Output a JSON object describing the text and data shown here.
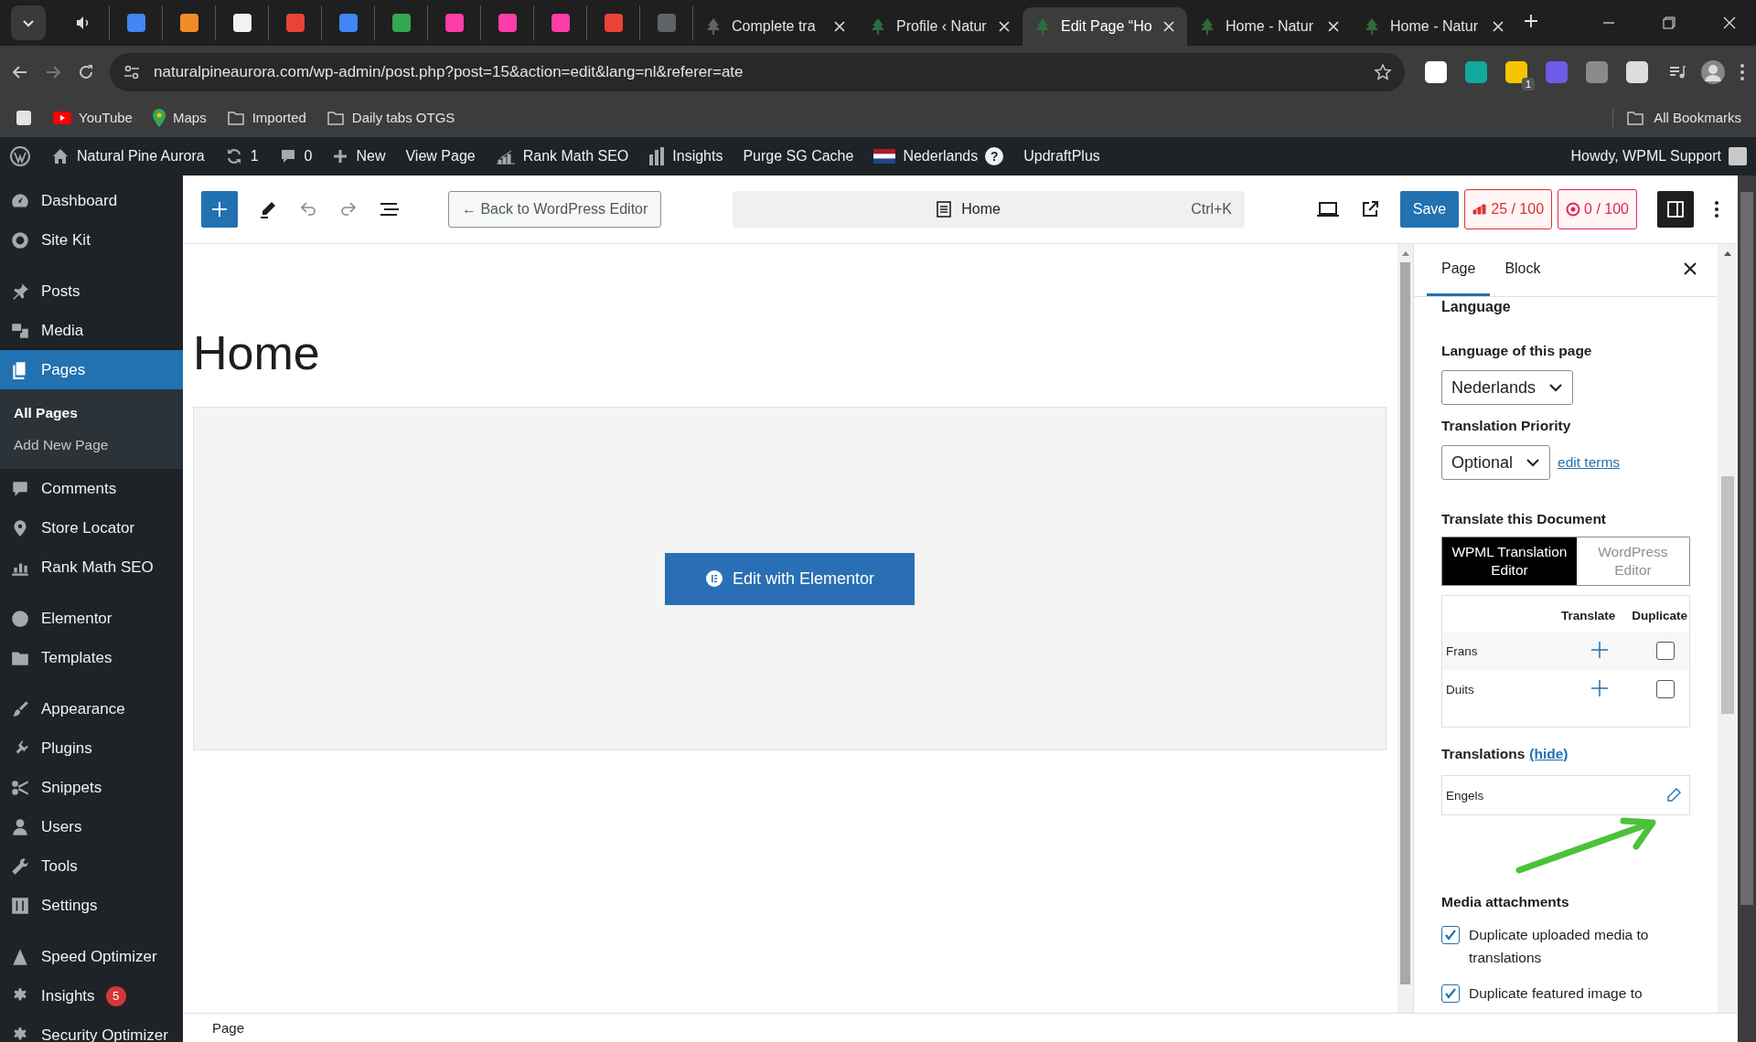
{
  "browser": {
    "tabs": [
      {
        "kind": "audio",
        "color": "#dddddd"
      },
      {
        "kind": "icon",
        "color": "#4285f4"
      },
      {
        "kind": "icon",
        "color": "#f28c28"
      },
      {
        "kind": "icon",
        "color": "#f2f2f2"
      },
      {
        "kind": "icon",
        "color": "#ea4335"
      },
      {
        "kind": "icon",
        "color": "#4285f4"
      },
      {
        "kind": "icon",
        "color": "#34a853"
      },
      {
        "kind": "icon",
        "color": "#ff3da8"
      },
      {
        "kind": "icon",
        "color": "#ff3da8"
      },
      {
        "kind": "icon",
        "color": "#ff3da8"
      },
      {
        "kind": "icon",
        "color": "#ea4335"
      },
      {
        "kind": "icon",
        "color": "#5f6368"
      },
      {
        "kind": "page",
        "title": "Complete tra",
        "selected": false,
        "color": "#5f6368"
      },
      {
        "kind": "page",
        "title": "Profile ‹ Natur",
        "selected": false,
        "color": "#2e6b3a"
      },
      {
        "kind": "page",
        "title": "Edit Page “Ho",
        "selected": true,
        "color": "#2e6b3a"
      },
      {
        "kind": "page",
        "title": "Home - Natur",
        "selected": false,
        "color": "#2e6b3a"
      },
      {
        "kind": "page",
        "title": "Home - Natur",
        "selected": false,
        "color": "#2e6b3a"
      }
    ],
    "address": "naturalpineaurora.com/wp-admin/post.php?post=15&action=edit&lang=nl&referer=ate",
    "extensions": [
      {
        "color": "#ffffff"
      },
      {
        "color": "#13a89e"
      },
      {
        "color": "#f7c500",
        "badge": "1"
      },
      {
        "color": "#6c5ce7"
      },
      {
        "color": "#8a8a8a"
      },
      {
        "color": "#dddddd"
      }
    ],
    "bookmarks": [
      {
        "label": "YouTube",
        "kind": "youtube"
      },
      {
        "label": "Maps",
        "kind": "maps"
      },
      {
        "label": "Imported",
        "kind": "folder"
      },
      {
        "label": "Daily tabs OTGS",
        "kind": "folder"
      }
    ],
    "all_bookmarks": "All Bookmarks"
  },
  "admin_bar": {
    "site": "Natural Pine Aurora",
    "updates": "1",
    "comments": "0",
    "new": "New",
    "items": [
      {
        "label": "View Page",
        "kind": "text"
      },
      {
        "label": "Rank Math SEO",
        "kind": "rankmath"
      },
      {
        "label": "Insights",
        "kind": "chart"
      },
      {
        "label": "Purge SG Cache",
        "kind": "text"
      }
    ],
    "language": "Nederlands",
    "help": "?",
    "updraft": "UpdraftPlus",
    "howdy": "Howdy, WPML Support"
  },
  "sidebar": {
    "groups": [
      [
        {
          "label": "Dashboard",
          "selected": false
        },
        {
          "label": "Site Kit",
          "selected": false
        }
      ],
      [
        {
          "label": "Posts",
          "selected": false
        },
        {
          "label": "Media",
          "selected": false
        },
        {
          "label": "Pages",
          "selected": true,
          "children": [
            {
              "label": "All Pages",
              "selected": true
            },
            {
              "label": "Add New Page",
              "selected": false
            }
          ]
        },
        {
          "label": "Comments",
          "selected": false
        },
        {
          "label": "Store Locator",
          "selected": false
        },
        {
          "label": "Rank Math SEO",
          "selected": false
        }
      ],
      [
        {
          "label": "Elementor",
          "selected": false
        },
        {
          "label": "Templates",
          "selected": false
        }
      ],
      [
        {
          "label": "Appearance",
          "selected": false
        },
        {
          "label": "Plugins",
          "selected": false
        },
        {
          "label": "Snippets",
          "selected": false
        },
        {
          "label": "Users",
          "selected": false
        },
        {
          "label": "Tools",
          "selected": false
        },
        {
          "label": "Settings",
          "selected": false
        }
      ],
      [
        {
          "label": "Speed Optimizer",
          "selected": false
        },
        {
          "label": "Insights",
          "selected": false,
          "badge": "5"
        },
        {
          "label": "Security Optimizer",
          "selected": false
        }
      ]
    ]
  },
  "editor": {
    "back": "← Back to WordPress Editor",
    "command": "Home",
    "shortcut": "Ctrl+K",
    "save": "Save",
    "scores": [
      {
        "text": "25 / 100",
        "color": "#dc3232"
      },
      {
        "text": "0 / 100",
        "color": "#e0245e"
      }
    ],
    "sidebar_open": true,
    "page_title": "Home",
    "elementor_button": "Edit with Elementor",
    "footer": "Page"
  },
  "panel": {
    "tabs": [
      {
        "label": "Page",
        "selected": true
      },
      {
        "label": "Block",
        "selected": false
      }
    ],
    "section": "Language",
    "language_label": "Language of this page",
    "language": "Nederlands",
    "priority_label": "Translation Priority",
    "priority": "Optional",
    "edit_terms": "edit terms",
    "translate_heading": "Translate this Document",
    "modes": [
      {
        "label": "WPML Translation Editor",
        "selected": true
      },
      {
        "label": "WordPress Editor",
        "selected": false
      }
    ],
    "columns": [
      "Translate",
      "Duplicate"
    ],
    "languages": [
      {
        "name": "Frans",
        "duplicate": false
      },
      {
        "name": "Duits",
        "duplicate": false
      }
    ],
    "translations_label": "Translations",
    "hide": "(hide)",
    "translations": [
      {
        "name": "Engels"
      }
    ],
    "media_heading": "Media attachments",
    "media_options": [
      {
        "label": "Duplicate uploaded media to translations",
        "checked": true
      },
      {
        "label": "Duplicate featured image to",
        "checked": true
      }
    ]
  }
}
